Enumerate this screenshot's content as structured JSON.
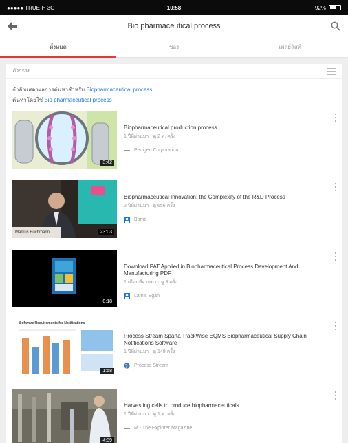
{
  "status_bar": {
    "carrier": "●●●●● TRUE-H  3G",
    "time": "10:58",
    "battery": "92%"
  },
  "app_bar": {
    "title": "Bio pharmaceutical process",
    "back_icon": "arrow-back-icon",
    "search_icon": "search-icon"
  },
  "tabs": [
    {
      "label": "ทั้งหมด",
      "active": true
    },
    {
      "label": "ช่อง",
      "active": false
    },
    {
      "label": "เพลย์ลิสต์",
      "active": false
    }
  ],
  "filter": {
    "label": "ตัวกรอง"
  },
  "correction": {
    "showing_prefix": "กำลังแสดงผลการค้นหาสำหรับ ",
    "showing_query": "Biopharmaceutical process",
    "instead_prefix": "ค้นหาโดยใช้ ",
    "instead_query": "Bio pharmaceutical process"
  },
  "videos": [
    {
      "title": "Biopharmaceutical production process",
      "info": "1 ปีที่ผ่านมา · ดู 2 พ. ครั้ง",
      "channel": "Pedigen Corporation",
      "duration": "3:42",
      "channel_icon": "channel-bar-icon"
    },
    {
      "title": "Biopharmaceutical Innovation: the Complexity of the R&D Process",
      "info": "2 ปีที่ผ่านมา · ดู 656 ครั้ง",
      "channel": "Bpmc",
      "duration": "23:03",
      "channel_icon": "channel-avatar-icon"
    },
    {
      "title": "Download PAT Applied in Biopharmaceutical Process Development And Manufacturing PDF",
      "info": "1 เดือนที่ผ่านมา · ดู 3 ครั้ง",
      "channel": "Lamis Egan",
      "duration": "0:18",
      "channel_icon": "channel-avatar-icon"
    },
    {
      "title": "Process Stream Sparta TrackWise EQMS Biopharmaceutical Supply Chain Notifications Software",
      "info": "1 ปีที่ผ่านมา · ดู 149 ครั้ง",
      "channel": "Process Stream",
      "duration": "1:58",
      "channel_icon": "channel-globe-icon"
    },
    {
      "title": "Harvesting cells to produce biopharmaceuticals",
      "info": "1 ปีที่ผ่านมา · ดู 1 พ. ครั้ง",
      "channel": "M - The Explorer Magazine",
      "duration": "4:39",
      "channel_icon": "channel-bar-icon"
    }
  ],
  "thumb_text": {
    "v2_caption": "Markus Buchmann",
    "v4_heading": "Software Requirements for Notifications"
  },
  "colors": {
    "accent": "#e53935",
    "link": "#1a73e8"
  }
}
